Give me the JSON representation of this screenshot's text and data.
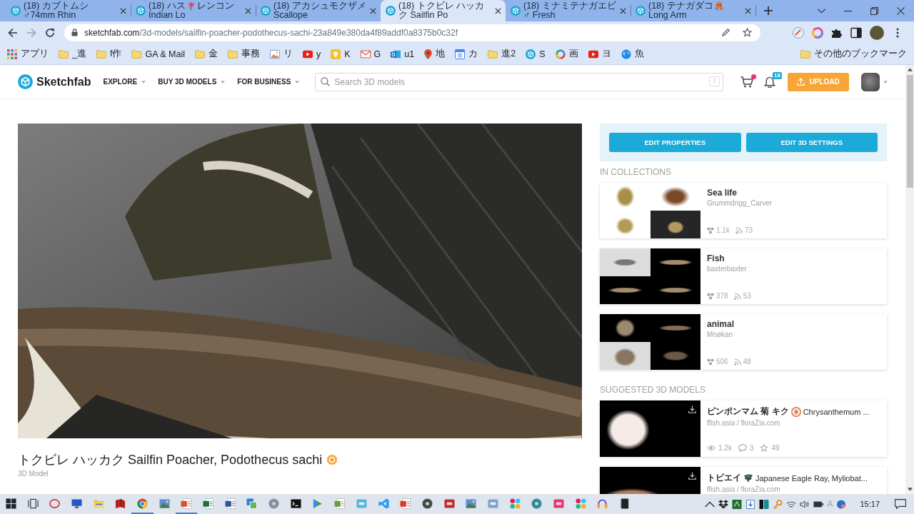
{
  "browser": {
    "tabs": [
      {
        "label": [
          "(18) カブトムシ ♂74mm Rhin"
        ],
        "selected": false
      },
      {
        "label": [
          "(18) ハス",
          "レンコン Indian Lo"
        ],
        "selected": false
      },
      {
        "label": [
          "(18) アカシュモクザメ Scallope"
        ],
        "selected": false
      },
      {
        "label": [
          "(18) トクビレ ハッカク Sailfin Po"
        ],
        "selected": true
      },
      {
        "label": [
          "(18) ミナミテナガエビ ♂ Fresh"
        ],
        "selected": false
      },
      {
        "label": [
          "(18) テナガダコ",
          "Long Arm"
        ],
        "selected": false
      }
    ],
    "address": {
      "domain": "sketchfab.com",
      "path": "/3d-models/sailfin-poacher-podothecus-sachi-23a849e380da4f89addf0a8375b0c32f"
    },
    "bookmarks": [
      {
        "kind": "apps",
        "label": "アプリ"
      },
      {
        "kind": "folder",
        "label": "_進"
      },
      {
        "kind": "folder",
        "label": "f作"
      },
      {
        "kind": "folder",
        "label": "GA & Mail"
      },
      {
        "kind": "folder",
        "label": "金"
      },
      {
        "kind": "folder",
        "label": "事務"
      },
      {
        "kind": "link",
        "label": "リ"
      },
      {
        "kind": "link",
        "label": "y"
      },
      {
        "kind": "link",
        "label": "K"
      },
      {
        "kind": "link",
        "label": "G"
      },
      {
        "kind": "link",
        "label": "u1"
      },
      {
        "kind": "link",
        "label": "地"
      },
      {
        "kind": "link",
        "label": "カ"
      },
      {
        "kind": "folder",
        "label": "進2"
      },
      {
        "kind": "link",
        "label": "S"
      },
      {
        "kind": "link",
        "label": "画"
      },
      {
        "kind": "link",
        "label": "ヨ"
      },
      {
        "kind": "link",
        "label": "魚"
      }
    ],
    "other_bookmarks": "その他のブックマーク"
  },
  "site": {
    "logo": "Sketchfab",
    "nav": [
      {
        "label": "EXPLORE"
      },
      {
        "label": "BUY 3D MODELS"
      },
      {
        "label": "FOR BUSINESS"
      }
    ],
    "search": {
      "placeholder": "Search 3D models",
      "shortcut_key": "/"
    },
    "notification_count": "18",
    "upload": "UPLOAD"
  },
  "model": {
    "title": "トクビレ ハッカク Sailfin Poacher, Podothecus sachi",
    "type": "3D Model"
  },
  "sidebar": {
    "actions": [
      "EDIT PROPERTIES",
      "EDIT 3D SETTINGS"
    ],
    "collections_heading": "IN COLLECTIONS",
    "collections": [
      {
        "name": "Sea life",
        "owner": "Grummdrigg_Carver",
        "models": "1.1k",
        "followers": "73"
      },
      {
        "name": "Fish",
        "owner": "baxterbaxter",
        "models": "378",
        "followers": "53"
      },
      {
        "name": "animal",
        "owner": "Moøkan",
        "models": "506",
        "followers": "48"
      }
    ],
    "suggested_heading": "SUGGESTED 3D MODELS",
    "suggested": [
      {
        "title": [
          "ピンポンマム 菊 キク",
          "Chrysanthemum ..."
        ],
        "author": "ffish.asia / floraZia.com",
        "views": "1.2k",
        "comments": "3",
        "likes": "49"
      },
      {
        "title": [
          "トビエイ",
          "Japanese Eagle Ray, Myliobat..."
        ],
        "author": "ffish.asia / floraZia.com"
      }
    ]
  },
  "taskbar": {
    "apps": [
      {
        "open": false
      },
      {
        "open": false
      },
      {
        "open": false
      },
      {
        "open": false
      },
      {
        "open": false
      },
      {
        "open": false
      },
      {
        "open": true
      },
      {
        "open": false
      },
      {
        "open": true
      },
      {
        "open": false
      },
      {
        "open": false
      },
      {
        "open": false
      },
      {
        "open": false
      },
      {
        "open": false
      },
      {
        "open": false
      },
      {
        "open": false
      },
      {
        "open": false
      },
      {
        "open": false
      },
      {
        "open": false
      },
      {
        "open": false
      },
      {
        "open": false
      },
      {
        "open": false
      },
      {
        "open": false
      },
      {
        "open": false
      },
      {
        "open": false
      },
      {
        "open": false
      },
      {
        "open": false
      },
      {
        "open": false
      },
      {
        "open": false
      }
    ],
    "ime": "A",
    "time": "15:17"
  }
}
